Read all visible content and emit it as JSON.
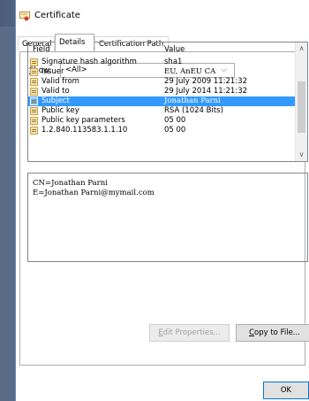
{
  "window": {
    "title": "Certificate"
  },
  "tabs": [
    {
      "label": "General"
    },
    {
      "label": "Details"
    },
    {
      "label": "Certification Path"
    }
  ],
  "show": {
    "label_u": "S",
    "label_rest": "how:",
    "value": "<All>"
  },
  "list": {
    "header": {
      "field": "Field",
      "value": "Value"
    },
    "rows": [
      {
        "field": "Signature hash algorithm",
        "value": "sha1"
      },
      {
        "field": "Issuer",
        "value": "EU, AnEU CA"
      },
      {
        "field": "Valid from",
        "value": "29 July 2009 11:21:32"
      },
      {
        "field": "Valid to",
        "value": "29 July 2014 11:21:32"
      },
      {
        "field": "Subject",
        "value": "Jonathan Parni"
      },
      {
        "field": "Public key",
        "value": "RSA (1024 Bits)"
      },
      {
        "field": "Public key parameters",
        "value": "05 00"
      },
      {
        "field": "1.2.840.113583.1.1.10",
        "value": "05 00"
      }
    ]
  },
  "detail": {
    "lines": [
      "CN=Jonathan Parni",
      "E=Jonathan Parni@mymail.com"
    ]
  },
  "buttons": {
    "edit_u": "E",
    "edit_rest": "dit Properties...",
    "copy_u": "C",
    "copy_rest": "opy to File...",
    "ok": "OK"
  },
  "colors": {
    "selection": "#3399ff",
    "accent": "#0078d7"
  }
}
